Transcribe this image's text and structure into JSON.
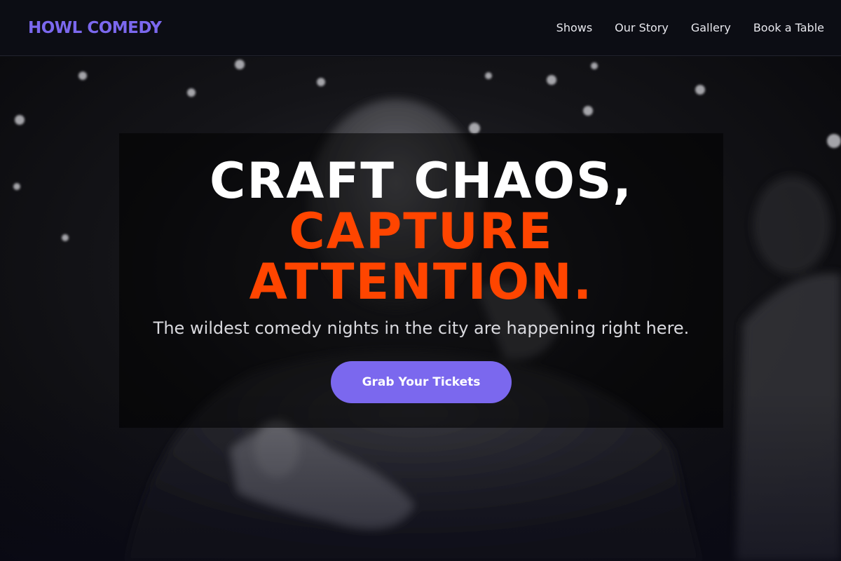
{
  "header": {
    "brand": "HOWL COMEDY",
    "nav": [
      {
        "label": "Shows"
      },
      {
        "label": "Our Story"
      },
      {
        "label": "Gallery"
      },
      {
        "label": "Book a Table"
      }
    ]
  },
  "hero": {
    "headline": {
      "line1": "CRAFT CHAOS,",
      "line2": "CAPTURE",
      "line3": "ATTENTION."
    },
    "subtitle": "The wildest comedy nights in the city are happening right here.",
    "cta_label": "Grab Your Tickets",
    "background_image": "black-and-white photo of comedian on stage pointing at the audience"
  },
  "colors": {
    "brand": "#7b68ee",
    "accent": "#ff4500",
    "background": "#0a0b10",
    "button": "#7b68ee"
  }
}
